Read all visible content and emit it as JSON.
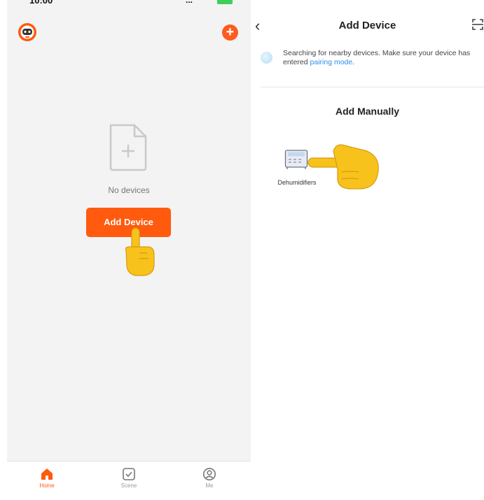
{
  "left_screen": {
    "status": {
      "time": "10:00",
      "signal": "..."
    },
    "empty_state": {
      "text": "No devices"
    },
    "add_device_button": "Add Device",
    "tabs": [
      {
        "label": "Home",
        "icon": "home-icon",
        "active": true
      },
      {
        "label": "Scene",
        "icon": "scene-icon",
        "active": false
      },
      {
        "label": "Me",
        "icon": "profile-icon",
        "active": false
      }
    ]
  },
  "right_screen": {
    "title": "Add Device",
    "searching_text": "Searching for nearby devices. Make sure your device has entered ",
    "pairing_link": "pairing mode",
    "searching_suffix": ".",
    "section_title": "Add Manually",
    "device_label": "Dehumidifiers"
  },
  "colors": {
    "accent": "#ff5a0e",
    "link": "#2a8fe8",
    "battery": "#3ecf5a"
  }
}
